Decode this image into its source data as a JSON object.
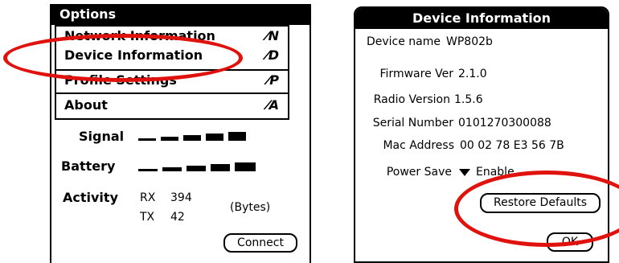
{
  "left": {
    "menu_title": "Options",
    "menu_items": [
      {
        "label": "Network Information",
        "shortcut": "⁄N"
      },
      {
        "label": "Device Information",
        "shortcut": "⁄D"
      },
      {
        "label": "Profile Settings",
        "shortcut": "⁄P"
      },
      {
        "label": "About",
        "shortcut": "⁄A"
      }
    ],
    "signal_label": "Signal",
    "battery_label": "Battery",
    "activity_label": "Activity",
    "rx_label": "RX",
    "rx_value": "394",
    "tx_label": "TX",
    "tx_value": "42",
    "bytes_label": "(Bytes)",
    "connect_label": "Connect"
  },
  "right": {
    "title": "Device Information",
    "fields": [
      {
        "label": "Device name",
        "value": "WP802b"
      },
      {
        "label": "Firmware Ver",
        "value": "2.1.0"
      },
      {
        "label": "Radio Version",
        "value": "1.5.6"
      },
      {
        "label": "Serial Number",
        "value": "0101270300088"
      },
      {
        "label": "Mac Address",
        "value": "00 02 78 E3 56 7B"
      }
    ],
    "power_save_label": "Power Save",
    "power_save_value": "Enable",
    "restore_label": "Restore Defaults",
    "ok_label": "OK"
  },
  "annotation_color": "#e0120d"
}
